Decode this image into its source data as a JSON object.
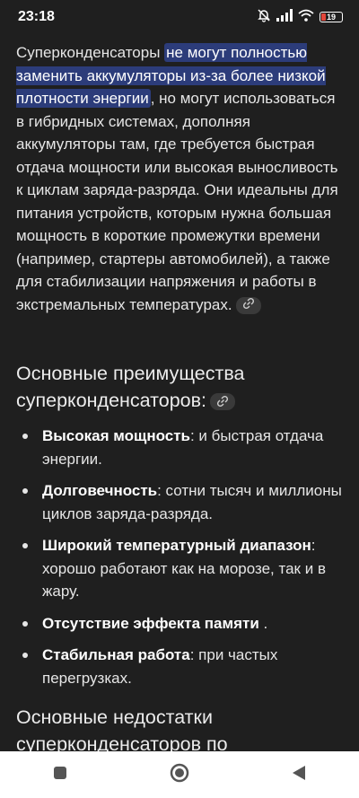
{
  "status": {
    "time": "23:18",
    "battery": "19"
  },
  "article": {
    "para_before_highlight": "Суперконденсаторы ",
    "para_highlight": "не могут полностью заменить аккумуляторы из-за более низкой плотности энергии",
    "para_after_highlight": ", но могут использоваться в гибридных системах, дополняя аккумуляторы там, где требуется быстрая отдача мощности или высокая выносливость к циклам заряда-разряда. Они идеальны для питания устройств, которым нужна большая мощность в короткие промежутки времени (например, стартеры автомобилей), а также для стабилизации напряжения и работы в экстремальных температурах.",
    "advantages_heading": "Основные преимущества суперконденсаторов:",
    "advantages": [
      {
        "term": "Высокая мощность",
        "desc": ": и быстрая отдача энергии."
      },
      {
        "term": "Долговечность",
        "desc": ": сотни тысяч и миллионы циклов заряда-разряда."
      },
      {
        "term": "Широкий температурный диапазон",
        "desc": ": хорошо работают как на морозе, так и в жару."
      },
      {
        "term": "Отсутствие эффекта памяти",
        "desc": " ."
      },
      {
        "term": "Стабильная работа",
        "desc": ": при частых перегрузках."
      }
    ],
    "disadvantages_heading": "Основные недостатки суперконденсаторов по"
  },
  "icons": {
    "silent": "bell-off-icon",
    "signal": "signal-icon",
    "wifi": "wifi-icon",
    "link": "link-icon",
    "recents": "square-icon",
    "home": "circle-icon",
    "back": "triangle-back-icon"
  }
}
